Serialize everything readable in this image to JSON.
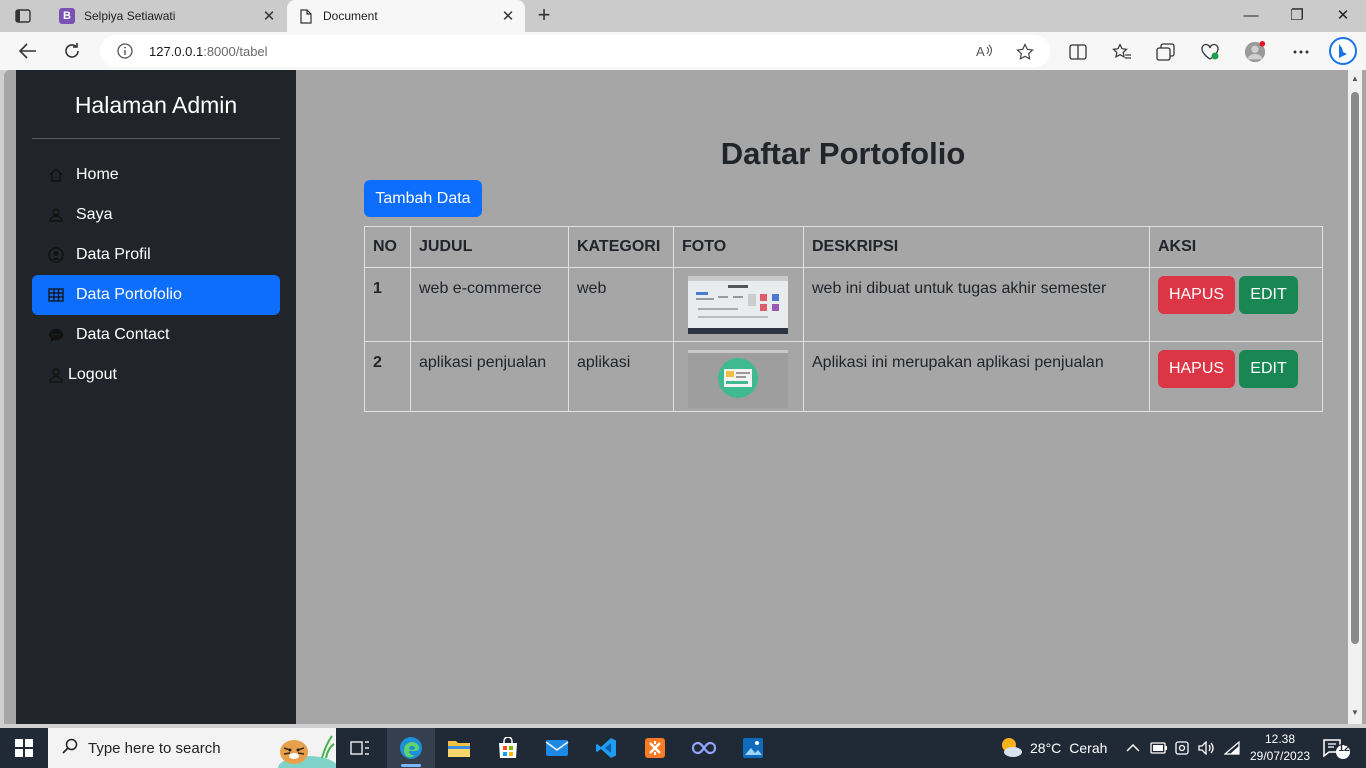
{
  "browser": {
    "tabs": [
      {
        "label": "Selpiya Setiawati",
        "favicon": "bootstrap-icon",
        "active": false
      },
      {
        "label": "Document",
        "favicon": "document-icon",
        "active": true
      }
    ],
    "url_host": "127.0.0.1",
    "url_rest": ":8000/tabel"
  },
  "sidebar": {
    "title": "Halaman Admin",
    "items": [
      {
        "label": "Home",
        "icon": "house-icon"
      },
      {
        "label": "Saya",
        "icon": "person-icon"
      },
      {
        "label": "Data Profil",
        "icon": "person-circle-icon"
      },
      {
        "label": "Data Portofolio",
        "icon": "table-icon",
        "active": true
      },
      {
        "label": "Data Contact",
        "icon": "chat-icon"
      },
      {
        "label": "Logout",
        "icon": "person-outline-icon"
      }
    ]
  },
  "main": {
    "title": "Daftar Portofolio",
    "add_button": "Tambah Data",
    "table": {
      "headers": [
        "NO",
        "JUDUL",
        "KATEGORI",
        "FOTO",
        "DESKRIPSI",
        "AKSI"
      ],
      "rows": [
        {
          "no": "1",
          "judul": "web e-commerce",
          "kategori": "web",
          "deskripsi": "web ini dibuat untuk tugas akhir semester",
          "delete": "HAPUS",
          "edit": "EDIT"
        },
        {
          "no": "2",
          "judul": "aplikasi penjualan",
          "kategori": "aplikasi",
          "deskripsi": "Aplikasi ini merupakan aplikasi penjualan",
          "delete": "HAPUS",
          "edit": "EDIT"
        }
      ]
    }
  },
  "taskbar": {
    "search_placeholder": "Type here to search",
    "weather_temp": "28°C",
    "weather_desc": "Cerah",
    "time": "12.38",
    "date": "29/07/2023",
    "notifications": "12"
  },
  "colors": {
    "primary": "#0d6efd",
    "danger": "#dc3545",
    "success": "#198754",
    "sidebar": "#212529",
    "content_bg": "#a6a6a6"
  }
}
